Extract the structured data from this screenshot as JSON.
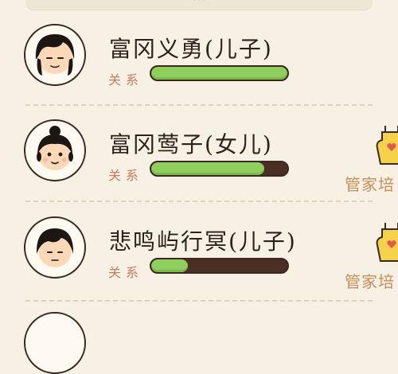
{
  "header": {
    "tab_text": "…"
  },
  "members": [
    {
      "name": "富冈义勇(儿子)",
      "relation_label": "关系",
      "relation_level": 1.0,
      "badge": null
    },
    {
      "name": "富冈莺子(女儿)",
      "relation_label": "关系",
      "relation_level": 0.83,
      "badge": "管家培"
    },
    {
      "name": "悲鸣屿行冥(儿子)",
      "relation_label": "关系",
      "relation_level": 0.27,
      "badge": "管家培"
    }
  ],
  "colors": {
    "bar_fill": "#8fcf5e",
    "bar_empty": "#4b2f25",
    "background": "#f6f1e4",
    "label": "#c97b5c"
  },
  "icons": {
    "apron": "apron-heart-icon"
  }
}
